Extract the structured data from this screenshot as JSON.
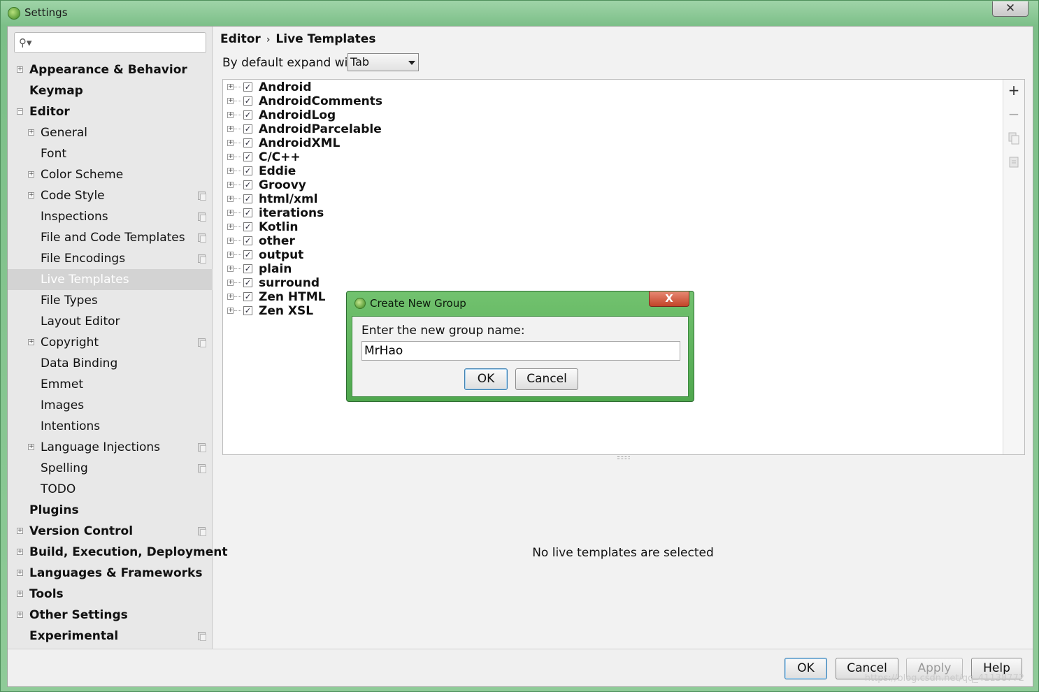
{
  "window": {
    "title": "Settings"
  },
  "search": {
    "placeholder": ""
  },
  "sidebar": {
    "items": [
      {
        "label": "Appearance & Behavior",
        "level": 0,
        "expandable": true,
        "expanded": false,
        "copy_icon": false
      },
      {
        "label": "Keymap",
        "level": 0,
        "expandable": false,
        "copy_icon": false
      },
      {
        "label": "Editor",
        "level": 0,
        "expandable": true,
        "expanded": true,
        "copy_icon": false
      },
      {
        "label": "General",
        "level": 1,
        "expandable": true,
        "expanded": false,
        "copy_icon": false
      },
      {
        "label": "Font",
        "level": 1,
        "expandable": false,
        "copy_icon": false
      },
      {
        "label": "Color Scheme",
        "level": 1,
        "expandable": true,
        "expanded": false,
        "copy_icon": false
      },
      {
        "label": "Code Style",
        "level": 1,
        "expandable": true,
        "expanded": false,
        "copy_icon": true
      },
      {
        "label": "Inspections",
        "level": 1,
        "expandable": false,
        "copy_icon": true
      },
      {
        "label": "File and Code Templates",
        "level": 1,
        "expandable": false,
        "copy_icon": true
      },
      {
        "label": "File Encodings",
        "level": 1,
        "expandable": false,
        "copy_icon": true
      },
      {
        "label": "Live Templates",
        "level": 1,
        "expandable": false,
        "copy_icon": false,
        "selected": true
      },
      {
        "label": "File Types",
        "level": 1,
        "expandable": false,
        "copy_icon": false
      },
      {
        "label": "Layout Editor",
        "level": 1,
        "expandable": false,
        "copy_icon": false
      },
      {
        "label": "Copyright",
        "level": 1,
        "expandable": true,
        "expanded": false,
        "copy_icon": true
      },
      {
        "label": "Data Binding",
        "level": 1,
        "expandable": false,
        "copy_icon": false
      },
      {
        "label": "Emmet",
        "level": 1,
        "expandable": false,
        "copy_icon": false
      },
      {
        "label": "Images",
        "level": 1,
        "expandable": false,
        "copy_icon": false
      },
      {
        "label": "Intentions",
        "level": 1,
        "expandable": false,
        "copy_icon": false
      },
      {
        "label": "Language Injections",
        "level": 1,
        "expandable": true,
        "expanded": false,
        "copy_icon": true
      },
      {
        "label": "Spelling",
        "level": 1,
        "expandable": false,
        "copy_icon": true
      },
      {
        "label": "TODO",
        "level": 1,
        "expandable": false,
        "copy_icon": false
      },
      {
        "label": "Plugins",
        "level": 0,
        "expandable": false,
        "copy_icon": false
      },
      {
        "label": "Version Control",
        "level": 0,
        "expandable": true,
        "expanded": false,
        "copy_icon": true
      },
      {
        "label": "Build, Execution, Deployment",
        "level": 0,
        "expandable": true,
        "expanded": false,
        "copy_icon": false
      },
      {
        "label": "Languages & Frameworks",
        "level": 0,
        "expandable": true,
        "expanded": false,
        "copy_icon": false
      },
      {
        "label": "Tools",
        "level": 0,
        "expandable": true,
        "expanded": false,
        "copy_icon": false
      },
      {
        "label": "Other Settings",
        "level": 0,
        "expandable": true,
        "expanded": false,
        "copy_icon": false
      },
      {
        "label": "Experimental",
        "level": 0,
        "expandable": false,
        "copy_icon": true
      }
    ]
  },
  "main": {
    "breadcrumb": {
      "parent": "Editor",
      "separator": "›",
      "current": "Live Templates"
    },
    "expand_label": "By default expand with",
    "expand_value": "Tab",
    "template_groups": [
      {
        "name": "Android",
        "checked": true
      },
      {
        "name": "AndroidComments",
        "checked": true
      },
      {
        "name": "AndroidLog",
        "checked": true
      },
      {
        "name": "AndroidParcelable",
        "checked": true
      },
      {
        "name": "AndroidXML",
        "checked": true
      },
      {
        "name": "C/C++",
        "checked": true
      },
      {
        "name": "Eddie",
        "checked": true
      },
      {
        "name": "Groovy",
        "checked": true
      },
      {
        "name": "html/xml",
        "checked": true
      },
      {
        "name": "iterations",
        "checked": true
      },
      {
        "name": "Kotlin",
        "checked": true
      },
      {
        "name": "other",
        "checked": true
      },
      {
        "name": "output",
        "checked": true
      },
      {
        "name": "plain",
        "checked": true
      },
      {
        "name": "surround",
        "checked": true
      },
      {
        "name": "Zen HTML",
        "checked": true
      },
      {
        "name": "Zen XSL",
        "checked": true
      }
    ],
    "toolbar": {
      "add": "+",
      "remove": "−"
    },
    "no_selection_text": "No live templates are selected"
  },
  "buttons": {
    "ok": "OK",
    "cancel": "Cancel",
    "apply": "Apply",
    "help": "Help"
  },
  "watermark": "https://blog.csdn.net/qq_41138772",
  "dialog": {
    "title": "Create New Group",
    "close": "X",
    "label": "Enter the new group name:",
    "input_value": "MrHao",
    "ok": "OK",
    "cancel": "Cancel"
  },
  "colors": {
    "window_frame": "#7cbf88",
    "dialog_frame": "#4fa74e",
    "selection": "#d3d3d3"
  }
}
